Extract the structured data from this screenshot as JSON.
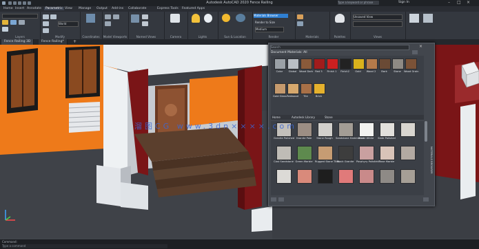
{
  "app": {
    "title": "Autodesk AutoCAD 2020   Fence Railing",
    "search_placeholder": "Type a keyword or phrase",
    "user": "Sign In"
  },
  "menus": [
    "Home",
    "Insert",
    "Annotate",
    "Parametric",
    "View",
    "Manage",
    "Output",
    "Add-ins",
    "Collaborate",
    "Express Tools",
    "Featured Apps"
  ],
  "ribbon": {
    "groups": [
      "Layers",
      "Modify",
      "Coordinates",
      "Model Viewports",
      "Named Views",
      "Camera",
      "Lights",
      "Sun & Location",
      "Render",
      "Materials",
      "Palettes",
      "Views"
    ],
    "materials_browser_label": "Materials Browser",
    "render_label": "Render to Size",
    "render_preset": "Medium",
    "views_value": "Unsaved View",
    "coord_world": "World"
  },
  "doc_tabs": [
    "Fence Railing 3D",
    "Fence Railing*"
  ],
  "materials_browser": {
    "title": "MATERIALS BROWSER",
    "search_placeholder": "Search",
    "doc_header": "Document Materials: All",
    "doc_items": [
      "Color",
      "Global",
      "Wood Dark",
      "Red 5",
      "Finish 1",
      "Finish2",
      "Gold",
      "Wood 2",
      "Bark",
      "Stone",
      "Wood Grain",
      "Gold Glass",
      "Redwood",
      "Tile",
      "Brick",
      "Wood Dark 2",
      "Stone Glass",
      "Sand",
      "Yellow"
    ],
    "lib_breadcrumb": [
      "Home",
      "Autodesk Library",
      "Stone"
    ],
    "lib_items": [
      "Granite Polished",
      "Granite Pale",
      "Stone Rough",
      "Sandstone Hammered",
      "Stone White",
      "Slate Polished",
      "Cast Sandstone",
      "Green Marble",
      "Rugged Stone Tiles",
      "Black Granite",
      "Porphyry Polished",
      "Rose Marble",
      "Crazy Paving",
      "Brick Red",
      "Basalt",
      "Pink Granite",
      "Rose Polished",
      "Stone Wall"
    ],
    "watermark": "溜图CG  www.3dn××××.com"
  },
  "command": {
    "history": "Command:",
    "placeholder": "Type a command"
  },
  "colors": {
    "accent": "#2f7fd1",
    "orange": "#f07a19",
    "maroon": "#7a1517",
    "wall_white": "#e9edf0"
  }
}
